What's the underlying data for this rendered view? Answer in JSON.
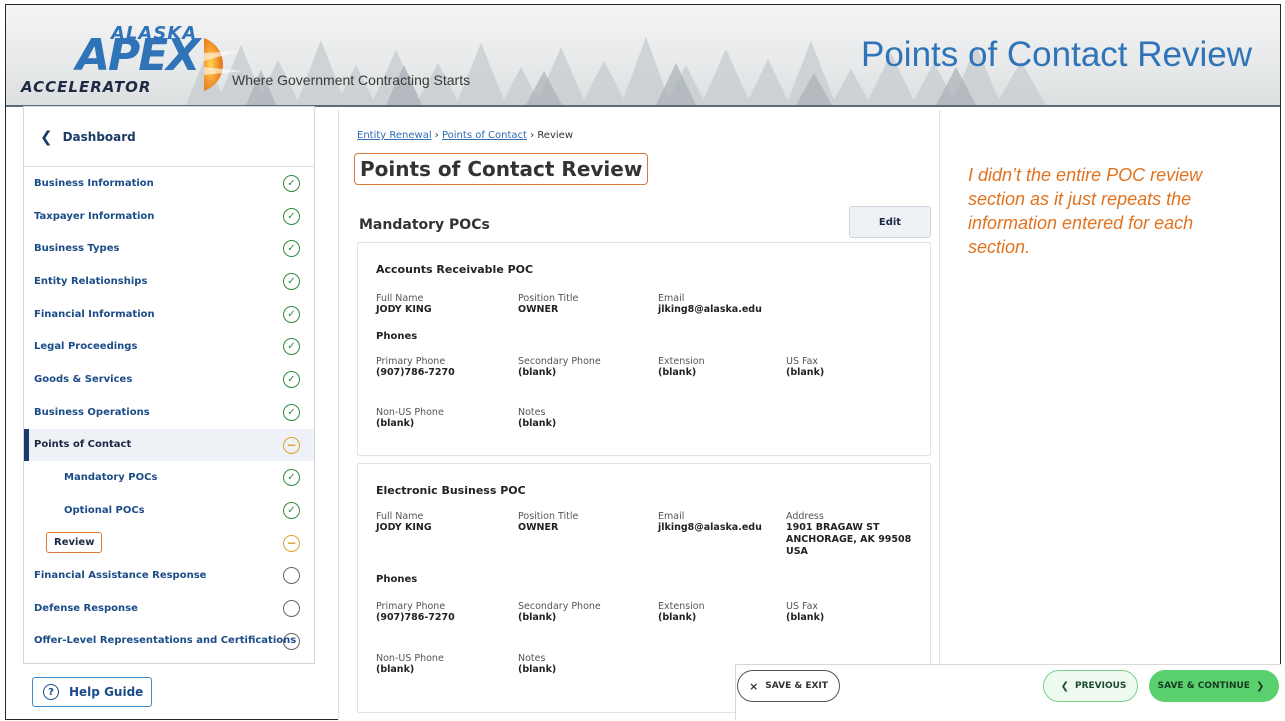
{
  "banner": {
    "logo_line1": "ALASKA",
    "logo_line2": "APEX",
    "logo_line3": "ACCELERATOR",
    "tagline": "Where Government Contracting Starts",
    "slide_title": "Points of Contact Review"
  },
  "sidebar": {
    "dashboard_label": "Dashboard",
    "items": [
      {
        "label": "Business Information",
        "status": "complete"
      },
      {
        "label": "Taxpayer Information",
        "status": "complete"
      },
      {
        "label": "Business Types",
        "status": "complete"
      },
      {
        "label": "Entity Relationships",
        "status": "complete"
      },
      {
        "label": "Financial Information",
        "status": "complete"
      },
      {
        "label": "Legal Proceedings",
        "status": "complete"
      },
      {
        "label": "Goods & Services",
        "status": "complete"
      },
      {
        "label": "Business Operations",
        "status": "complete"
      },
      {
        "label": "Points of Contact",
        "status": "in-progress"
      },
      {
        "label": "Mandatory POCs",
        "status": "complete"
      },
      {
        "label": "Optional POCs",
        "status": "complete"
      },
      {
        "label": "Review",
        "status": "in-progress"
      },
      {
        "label": "Financial Assistance Response",
        "status": "not-started"
      },
      {
        "label": "Defense Response",
        "status": "not-started"
      },
      {
        "label": "Offer-Level Representations and Certifications",
        "status": "not-started"
      }
    ],
    "help_label": "Help Guide"
  },
  "breadcrumb": {
    "item1": "Entity Renewal",
    "sep": "›",
    "item2": "Points of Contact",
    "item3": "Review"
  },
  "main": {
    "page_title": "Points of Contact Review",
    "section_title": "Mandatory POCs",
    "edit_label": "Edit",
    "accounts_poc": {
      "title": "Accounts Receivable POC",
      "full_name_label": "Full Name",
      "full_name": "JODY KING",
      "position_label": "Position Title",
      "position": "OWNER",
      "email_label": "Email",
      "email": "jlking8@alaska.edu",
      "phones_label": "Phones",
      "primary_label": "Primary Phone",
      "primary": "(907)786-7270",
      "secondary_label": "Secondary Phone",
      "secondary": "(blank)",
      "extension_label": "Extension",
      "extension": "(blank)",
      "fax_label": "US Fax",
      "fax": "(blank)",
      "nonus_label": "Non-US Phone",
      "nonus": "(blank)",
      "notes_label": "Notes",
      "notes": "(blank)"
    },
    "electronic_poc": {
      "title": "Electronic Business POC",
      "full_name_label": "Full Name",
      "full_name": "JODY KING",
      "position_label": "Position Title",
      "position": "OWNER",
      "email_label": "Email",
      "email": "jlking8@alaska.edu",
      "address_label": "Address",
      "address_line1": "1901 BRAGAW ST",
      "address_line2": "ANCHORAGE, AK 99508",
      "address_line3": "USA",
      "phones_label": "Phones",
      "primary_label": "Primary Phone",
      "primary": "(907)786-7270",
      "secondary_label": "Secondary Phone",
      "secondary": "(blank)",
      "extension_label": "Extension",
      "extension": "(blank)",
      "fax_label": "US Fax",
      "fax": "(blank)",
      "nonus_label": "Non-US Phone",
      "nonus": "(blank)",
      "notes_label": "Notes",
      "notes": "(blank)"
    }
  },
  "note": "I didn’t the entire POC review section as it just repeats the information entered for each section.",
  "footer": {
    "save_exit": "SAVE & EXIT",
    "previous": "PREVIOUS",
    "save_continue": "SAVE & CONTINUE"
  },
  "colors": {
    "brand_blue": "#2f73b8",
    "nav_blue": "#1b4c87",
    "complete_green": "#2e8a3e",
    "in_progress_amber": "#e0a12a",
    "highlight_orange": "#d97a3a",
    "note_orange": "#e1731f",
    "continue_green": "#5bd06f"
  }
}
